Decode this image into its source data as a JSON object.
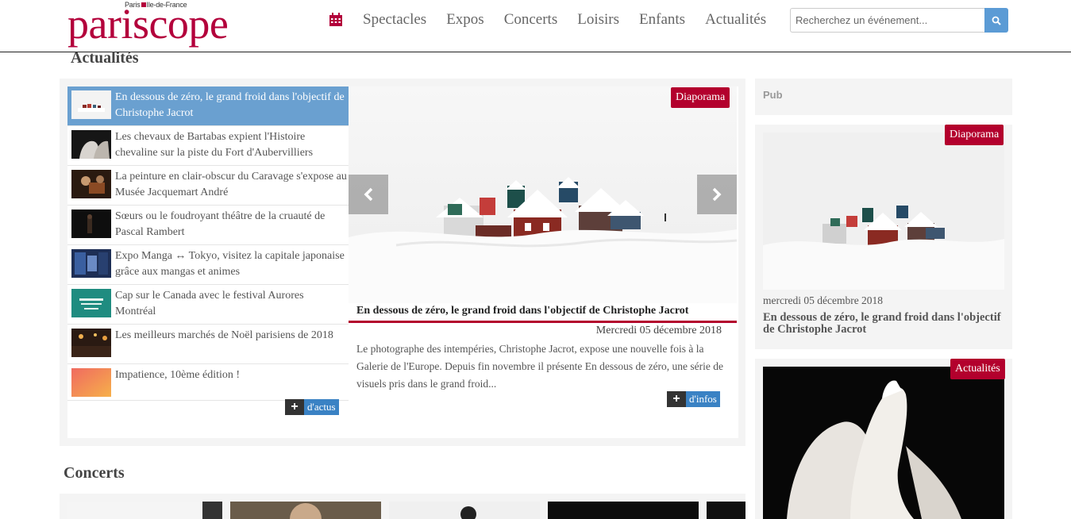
{
  "header": {
    "logo_sub_left": "Paris",
    "logo_sub_right": "Ile-de-France",
    "logo_main": "pariscope",
    "nav": [
      "Spectacles",
      "Expos",
      "Concerts",
      "Loisirs",
      "Enfants",
      "Actualités"
    ],
    "search_placeholder": "Recherchez un événement..."
  },
  "actualites": {
    "title": "Actualités",
    "items": [
      {
        "label": "En dessous de zéro, le grand froid dans l'objectif de Christophe Jacrot",
        "active": true
      },
      {
        "label": "Les chevaux de Bartabas expient l'Histoire chevaline sur la piste du Fort d'Aubervilliers"
      },
      {
        "label": "La peinture en clair-obscur du Caravage s'expose au Musée Jacquemart André"
      },
      {
        "label": "Sœurs ou le foudroyant théâtre de la cruauté de Pascal Rambert"
      },
      {
        "label": "Expo Manga ↔ Tokyo, visitez la capitale japonaise grâce aux mangas et animes"
      },
      {
        "label": "Cap sur le Canada avec le festival Aurores Montréal"
      },
      {
        "label": "Les meilleurs marchés de Noël parisiens de 2018"
      },
      {
        "label": "Impatience, 10ème édition !"
      }
    ],
    "more_label": "d'actus",
    "plus": "+",
    "hero": {
      "tag": "Diaporama",
      "title": "En dessous de zéro, le grand froid dans l'objectif de Christophe Jacrot",
      "date": "Mercredi 05 décembre 2018",
      "description": "Le photographe des intempéries, Christophe Jacrot, expose une nouvelle fois à la Galerie de l'Europe. Depuis fin novembre il présente En dessous de zéro, une série de visuels pris dans le grand froid...",
      "more_label": "d'infos"
    }
  },
  "sidebar": {
    "pub_label": "Pub",
    "card1": {
      "tag": "Diaporama",
      "date": "mercredi 05 décembre 2018",
      "title": "En dessous de zéro, le grand froid dans l'objectif de Christophe Jacrot"
    },
    "card2": {
      "tag": "Actualités"
    }
  },
  "concerts": {
    "title": "Concerts"
  },
  "colors": {
    "brand": "#b3003b",
    "accent": "#6aa0d0",
    "tag": "#b3002d",
    "button_blue": "#3a82c4"
  }
}
